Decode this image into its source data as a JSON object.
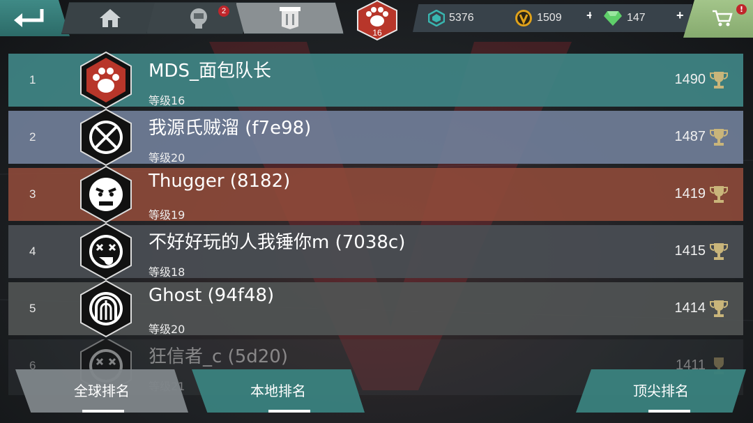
{
  "header": {
    "notification_count": "2",
    "player_level": "16",
    "currencies": [
      {
        "name": "crystal-currency",
        "value": "5376",
        "color": "#39b6b0"
      },
      {
        "name": "gold-currency",
        "value": "1509",
        "color": "#e0a21a"
      },
      {
        "name": "gem-currency",
        "value": "147",
        "color": "#5fcf6a"
      }
    ],
    "plus_label": "+",
    "shop_badge": "!"
  },
  "leaderboard": {
    "rows": [
      {
        "rank": "1",
        "name": "MDS_面包队长",
        "level": "等级16",
        "score": "1490",
        "emblem": "paw-emblem-icon"
      },
      {
        "rank": "2",
        "name": "我源氏贼溜 (f7e98)",
        "level": "等级20",
        "score": "1487",
        "emblem": "crossed-swords-emblem-icon"
      },
      {
        "rank": "3",
        "name": "Thugger (8182)",
        "level": "等级19",
        "score": "1419",
        "emblem": "angry-face-emblem-icon"
      },
      {
        "rank": "4",
        "name": "不好好玩的人我锤你m (7038c)",
        "level": "等级18",
        "score": "1415",
        "emblem": "dizzy-face-emblem-icon"
      },
      {
        "rank": "5",
        "name": "Ghost (94f48)",
        "level": "等级20",
        "score": "1414",
        "emblem": "arch-emblem-icon"
      },
      {
        "rank": "6",
        "name": "狂信者_c (5d20)",
        "level": "等级21",
        "score": "1411",
        "emblem": "dizzy-face-emblem-icon"
      }
    ]
  },
  "tabs": {
    "global": "全球排名",
    "local": "本地排名",
    "top": "顶尖排名"
  },
  "colors": {
    "accent_teal": "#3f8a86",
    "shop_green": "#a3c58a",
    "badge_red": "#c0262b",
    "emblem_red": "#b8362a"
  }
}
